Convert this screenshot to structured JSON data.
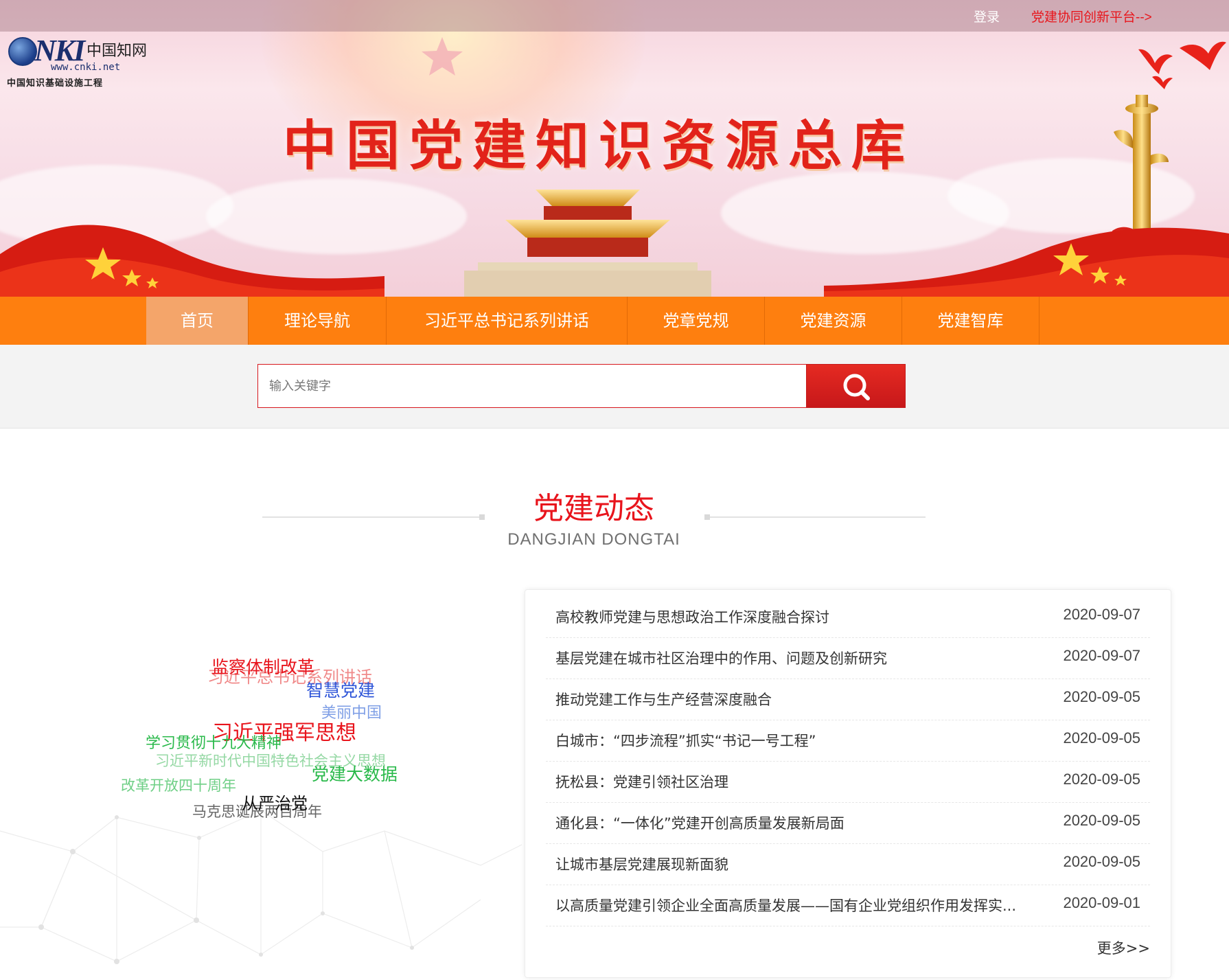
{
  "topbar": {
    "login_label": "登录",
    "platform_label": "党建协同创新平台-->"
  },
  "logo": {
    "brand": "NKI",
    "cn_name": "中国知网",
    "url": "www.cnki.net",
    "subtitle": "中国知识基础设施工程"
  },
  "banner": {
    "title": "中国党建知识资源总库"
  },
  "nav": {
    "items": [
      {
        "label": "首页",
        "active": true
      },
      {
        "label": "理论导航",
        "active": false
      },
      {
        "label": "习近平总书记系列讲话",
        "active": false
      },
      {
        "label": "党章党规",
        "active": false
      },
      {
        "label": "党建资源",
        "active": false
      },
      {
        "label": "党建智库",
        "active": false
      }
    ]
  },
  "search": {
    "placeholder": "输入关键字",
    "icon": "search-icon"
  },
  "section": {
    "title": "党建动态",
    "subtitle": "DANGJIAN DONGTAI"
  },
  "word_cloud": {
    "words": [
      {
        "text": "监察体制改革",
        "color": "#e8141c"
      },
      {
        "text": "习近平总书记系列讲话",
        "color": "#f08a8a"
      },
      {
        "text": "智慧党建",
        "color": "#2e55d8"
      },
      {
        "text": "美丽中国",
        "color": "#7f9fe6"
      },
      {
        "text": "习近平强军思想",
        "color": "#e8141c"
      },
      {
        "text": "学习贯彻十九大精神",
        "color": "#29b94a"
      },
      {
        "text": "习近平新时代中国特色社会主义思想",
        "color": "#95d8a4"
      },
      {
        "text": "党建大数据",
        "color": "#29b94a"
      },
      {
        "text": "改革开放四十周年",
        "color": "#6fcf86"
      },
      {
        "text": "从严治党",
        "color": "#111111"
      },
      {
        "text": "马克思诞辰两百周年",
        "color": "#666666"
      }
    ]
  },
  "news": {
    "items": [
      {
        "title": "高校教师党建与思想政治工作深度融合探讨",
        "date": "2020-09-07"
      },
      {
        "title": "基层党建在城市社区治理中的作用、问题及创新研究",
        "date": "2020-09-07"
      },
      {
        "title": "推动党建工作与生产经营深度融合",
        "date": "2020-09-05"
      },
      {
        "title": "白城市：“四步流程”抓实“书记一号工程”",
        "date": "2020-09-05"
      },
      {
        "title": "抚松县：党建引领社区治理",
        "date": "2020-09-05"
      },
      {
        "title": "通化县：“一体化”党建开创高质量发展新局面",
        "date": "2020-09-05"
      },
      {
        "title": "让城市基层党建展现新面貌",
        "date": "2020-09-05"
      },
      {
        "title": "以高质量党建引领企业全面高质量发展——国有企业党组织作用发挥实...",
        "date": "2020-09-01"
      }
    ],
    "more_label": "更多>>"
  },
  "colors": {
    "nav_bg": "#fe7f0f",
    "nav_active": "#f4a56a",
    "accent_red": "#e8141c",
    "search_btn": "#d01c1c"
  }
}
